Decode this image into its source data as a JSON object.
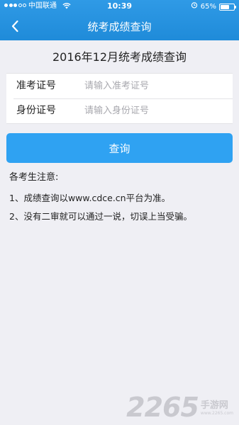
{
  "status_bar": {
    "carrier": "中国联通",
    "time": "10:39",
    "battery_text": "65%",
    "battery_level": 0.65
  },
  "nav": {
    "title": "统考成绩查询",
    "back_icon": "chevron-left-icon"
  },
  "page": {
    "heading": "2016年12月统考成绩查询"
  },
  "form": {
    "exam_number": {
      "label": "准考证号",
      "value": "",
      "placeholder": "请输入准考证号"
    },
    "id_number": {
      "label": "身份证号",
      "value": "",
      "placeholder": "请输入身份证号"
    }
  },
  "actions": {
    "query_label": "查询"
  },
  "notice": {
    "title": "各考生注意:",
    "items": [
      "1、成绩查询以www.cdce.cn平台为准。",
      "2、没有二审就可以通过一说，切误上当受骗。"
    ]
  },
  "watermark": {
    "number": "2265",
    "text": "手游网",
    "url": "www.2265.com"
  },
  "colors": {
    "header": "#1f8bd9",
    "button": "#2fa2f2",
    "background": "#efeff4"
  }
}
